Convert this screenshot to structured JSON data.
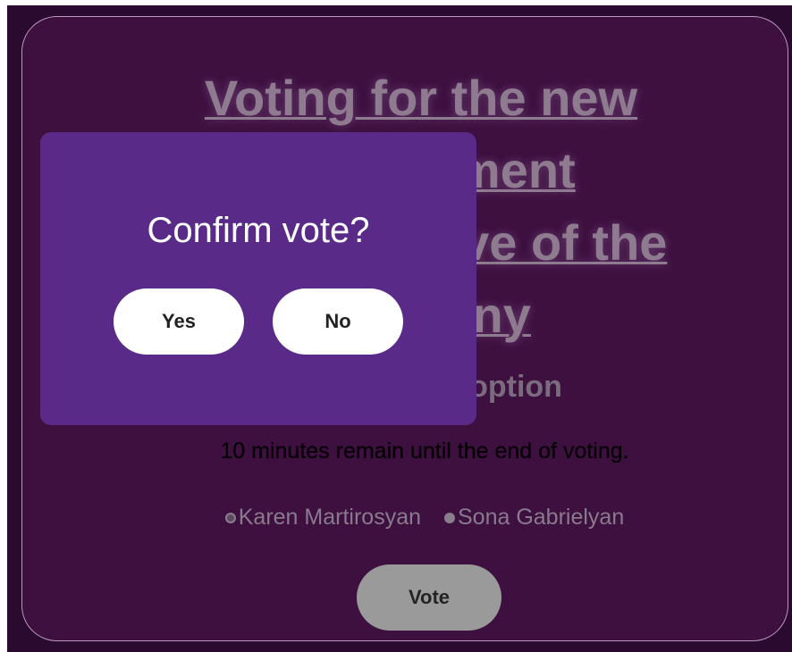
{
  "page": {
    "title": "Voting for the new management representative of the company",
    "subtitle": "Choose one option",
    "timer_text": "10 minutes remain until the end of voting.",
    "vote_button": "Vote"
  },
  "candidates": [
    {
      "name": "Karen Martirosyan"
    },
    {
      "name": "Sona Gabrielyan"
    }
  ],
  "modal": {
    "title": "Confirm vote?",
    "yes_label": "Yes",
    "no_label": "No"
  },
  "colors": {
    "background": "#2a0a2e",
    "card": "#3d1040",
    "modal": "#5a2a88",
    "modal_button": "#ffffff",
    "vote_button": "#9a9a9a"
  }
}
